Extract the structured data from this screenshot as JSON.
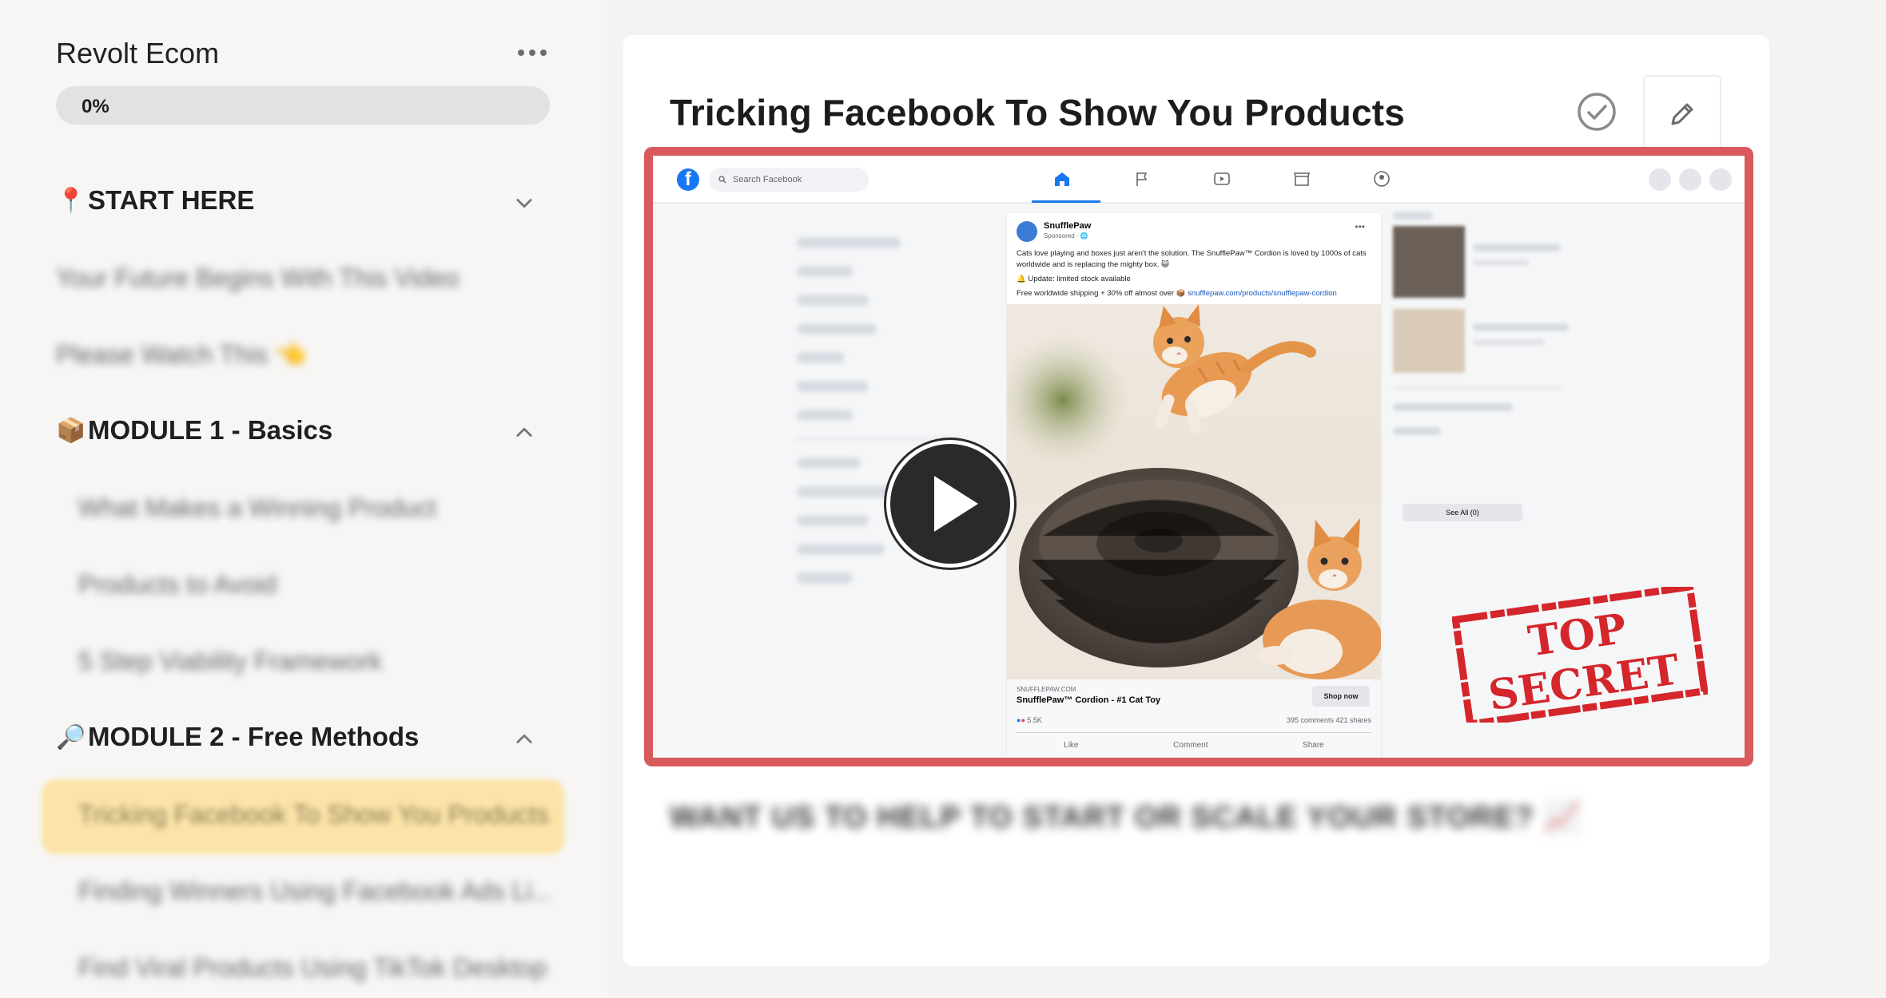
{
  "sidebar": {
    "course_title": "Revolt Ecom",
    "more_icon": "more-horizontal-icon",
    "progress": {
      "label": "0%",
      "value": 0
    },
    "sections": [
      {
        "emoji": "📍",
        "title": "START HERE",
        "expanded": false,
        "lessons": [
          "Your Future Begins With This Video",
          "Please Watch This 👈"
        ]
      },
      {
        "emoji": "📦",
        "title": "MODULE 1 - Basics",
        "expanded": true,
        "lessons": [
          "What Makes a Winning Product",
          "Products to Avoid",
          "5 Step Viability Framework"
        ]
      },
      {
        "emoji": "🔎",
        "title": "MODULE 2 - Free Methods",
        "expanded": true,
        "lessons": [
          "Tricking Facebook To Show You Products",
          "Finding Winners Using Facebook Ads Li...",
          "Find Viral Products Using TikTok Desktop"
        ]
      }
    ],
    "active_lesson": "Tricking Facebook To Show You Products"
  },
  "main": {
    "lesson_title": "Tricking Facebook To Show You Products",
    "complete_icon": "check-circle-icon",
    "edit_icon": "pencil-icon",
    "cta_text": "WANT US TO HELP TO START OR SCALE YOUR STORE? 📈"
  },
  "video": {
    "play_icon": "play-icon",
    "accent_border": "#d85a5c",
    "facebook": {
      "search_placeholder": "Search Facebook",
      "see_all": "See All (0)",
      "post": {
        "page_name": "SnufflePaw",
        "sponsored": "Sponsored · 🌐",
        "text_lines": [
          "Cats love playing and boxes just aren't the solution. The SnufflePaw™ Cordion is loved by 1000s of cats worldwide and is replacing the mighty box. 😺",
          "🔔 Update: limited stock available",
          "Free worldwide shipping + 30% off almost over 📦 "
        ],
        "link": "snufflepaw.com/products/snufflepaw-cordion",
        "domain": "SNUFFLEPAW.COM",
        "product": "SnufflePaw™ Cordion - #1 Cat Toy",
        "shop_now": "Shop now",
        "reactions": "5.5K",
        "comments_shares": "395 comments  421 shares",
        "actions": [
          "Like",
          "Comment",
          "Share"
        ]
      }
    },
    "stamp": {
      "line1": "TOP",
      "line2": "SECRET",
      "color": "#d4262b"
    }
  },
  "colors": {
    "sidebar_bg": "#f7f6f4",
    "active_lesson_bg": "#fbe4a8",
    "progress_bg": "#e3e2e0",
    "facebook_blue": "#1877f2"
  }
}
